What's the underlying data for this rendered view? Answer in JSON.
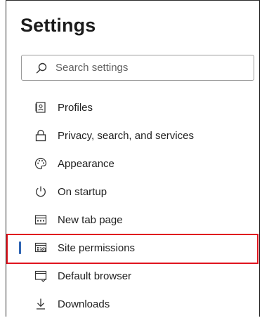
{
  "header": {
    "title": "Settings"
  },
  "search": {
    "placeholder": "Search settings",
    "icon": "search-icon"
  },
  "menu": {
    "items": [
      {
        "label": "Profiles",
        "icon": "profile-icon",
        "selected": false
      },
      {
        "label": "Privacy, search, and services",
        "icon": "lock-icon",
        "selected": false
      },
      {
        "label": "Appearance",
        "icon": "palette-icon",
        "selected": false
      },
      {
        "label": "On startup",
        "icon": "power-icon",
        "selected": false
      },
      {
        "label": "New tab page",
        "icon": "new-tab-icon",
        "selected": false
      },
      {
        "label": "Site permissions",
        "icon": "site-permissions-icon",
        "selected": true
      },
      {
        "label": "Default browser",
        "icon": "default-browser-icon",
        "selected": false
      },
      {
        "label": "Downloads",
        "icon": "download-icon",
        "selected": false
      }
    ]
  },
  "colors": {
    "accent": "#2f64b3",
    "highlight": "#e0141e"
  }
}
